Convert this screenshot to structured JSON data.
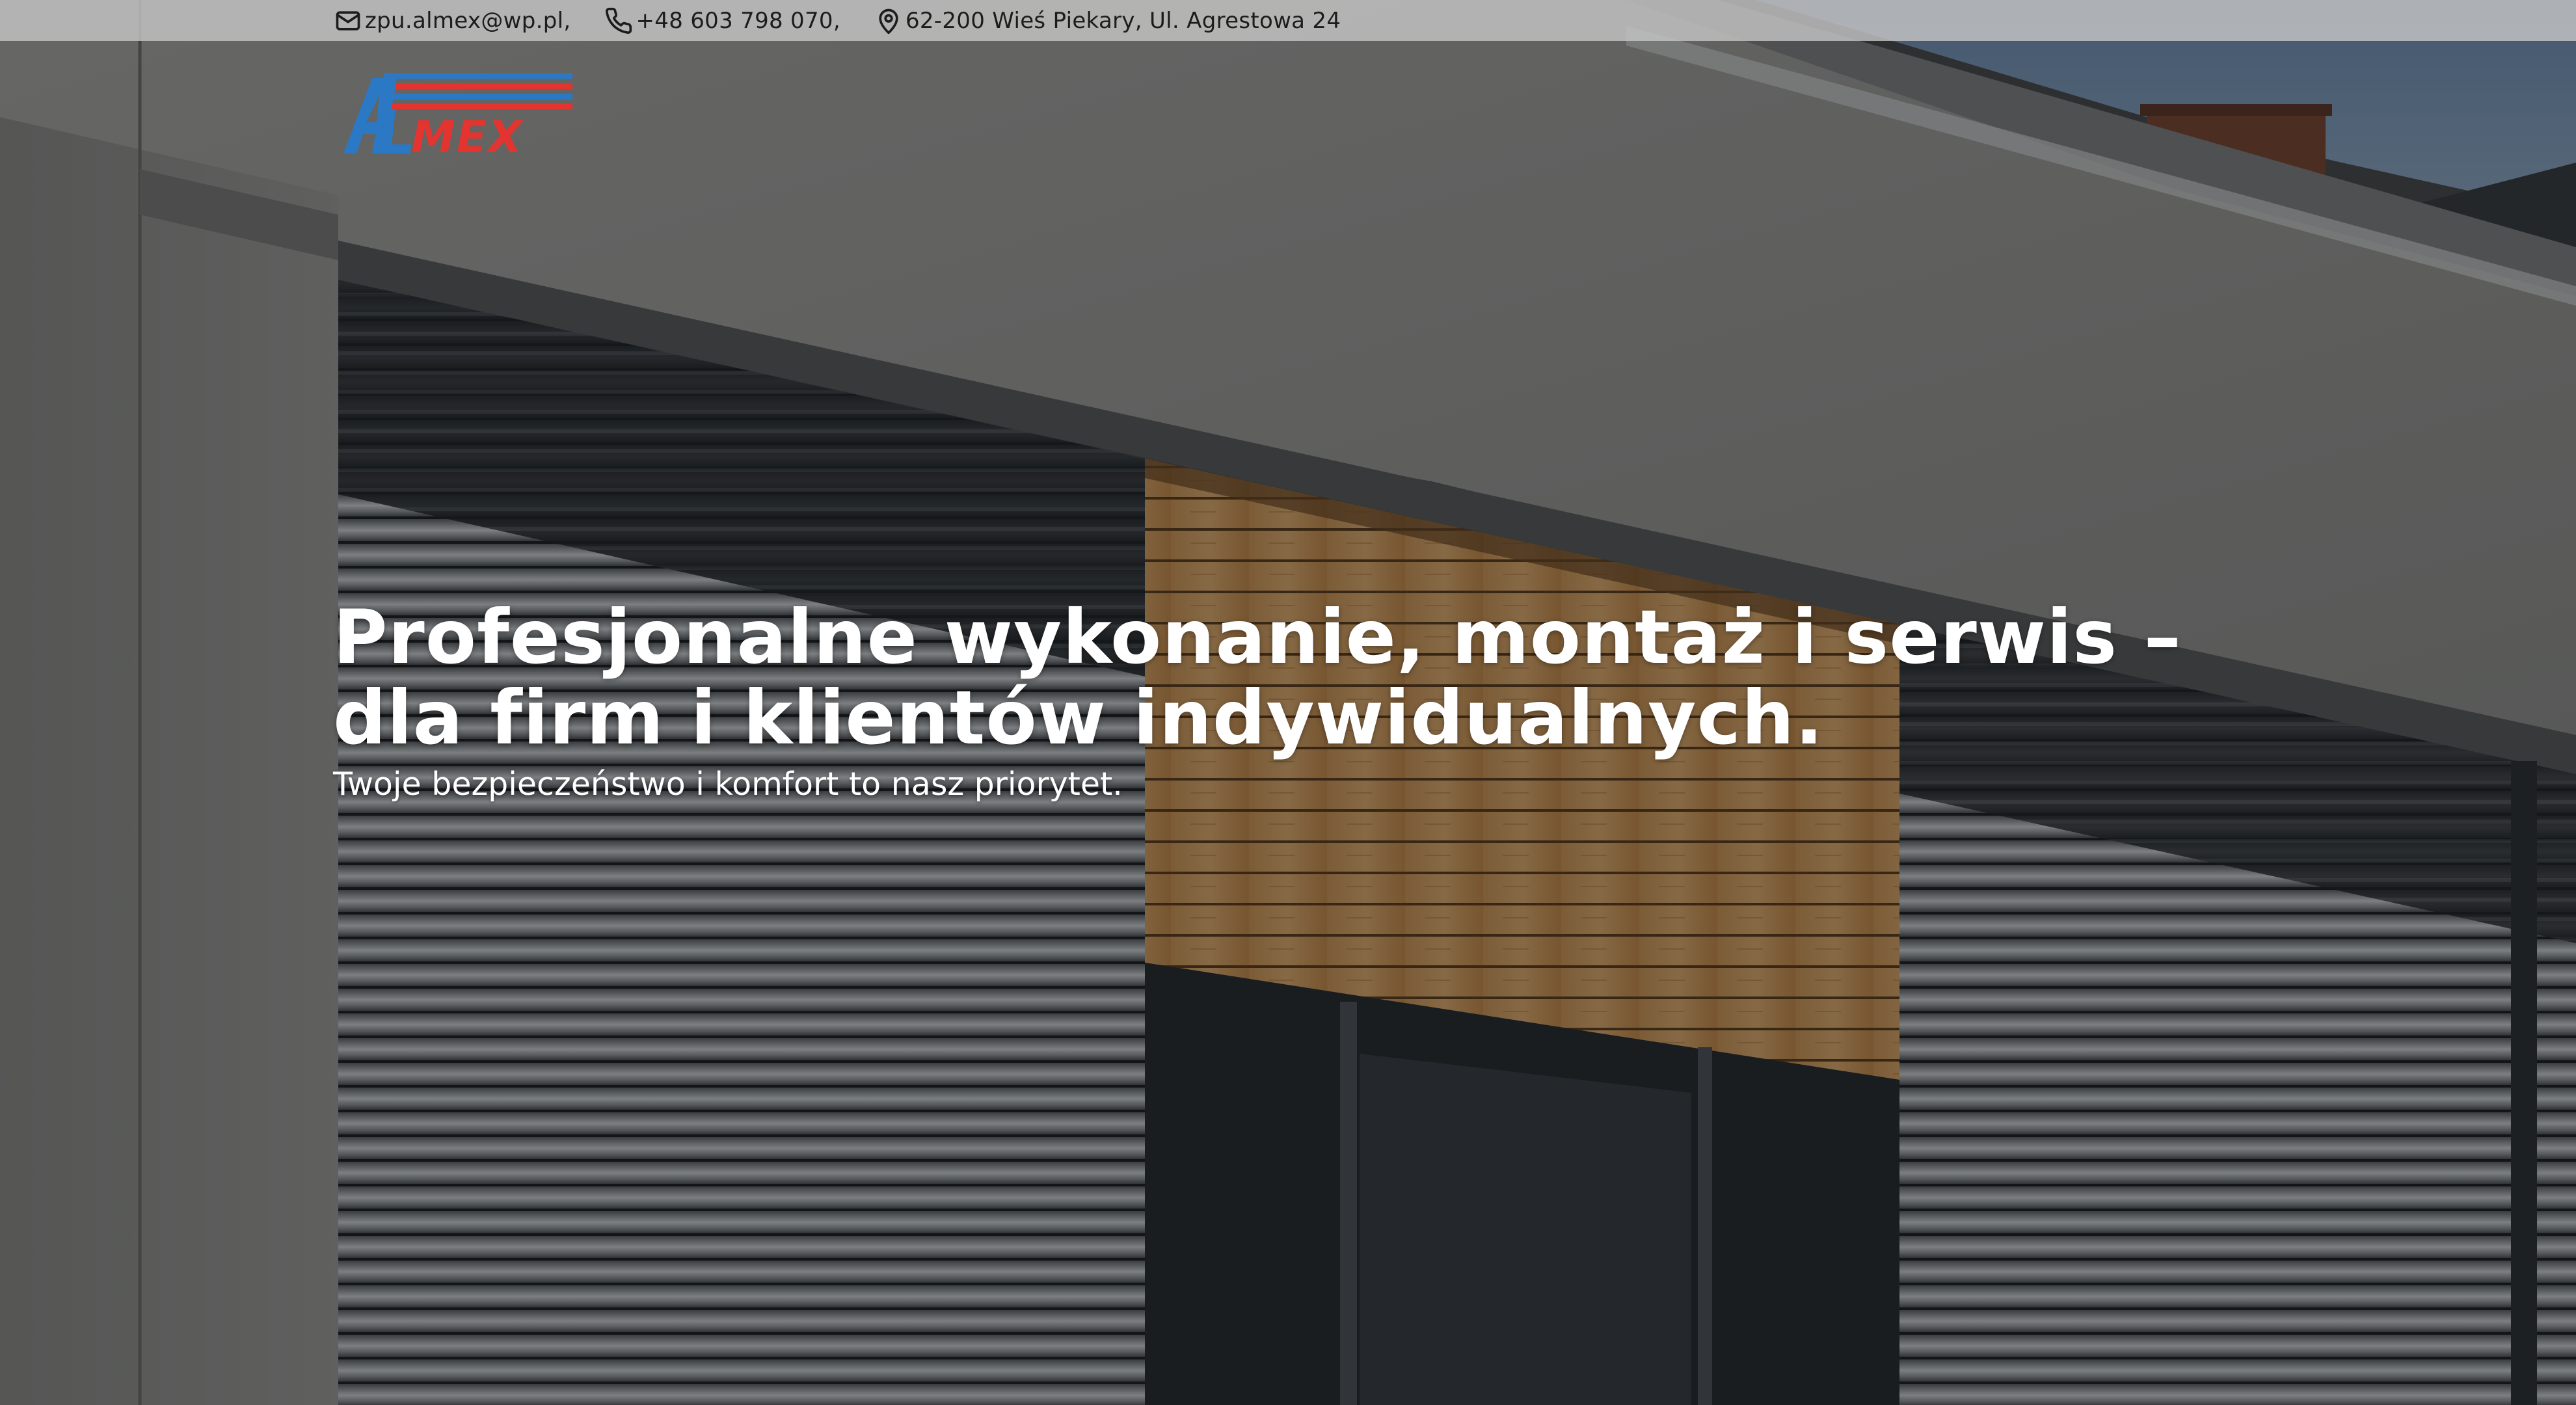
{
  "contact_bar": {
    "email": "zpu.almex@wp.pl,",
    "phone": "+48 603 798 070,",
    "address": "62-200 Wieś Piekary, Ul. Agrestowa 24",
    "icons": [
      "mail-icon",
      "phone-icon",
      "location-pin-icon"
    ]
  },
  "logo": {
    "text": "ALMEX",
    "colors": {
      "blue": "#2b78c4",
      "red": "#e3342f"
    }
  },
  "hero": {
    "title": "Profesjonalne wykonanie, montaż i serwis – dla firm i klientów indywidualnych.",
    "subtitle": "Twoje bezpieczeństwo i komfort to nasz priorytet."
  },
  "colors": {
    "text_light": "#ffffff",
    "topbar_bg": "#c4c4c4",
    "topbar_text": "#1c1c1c"
  }
}
